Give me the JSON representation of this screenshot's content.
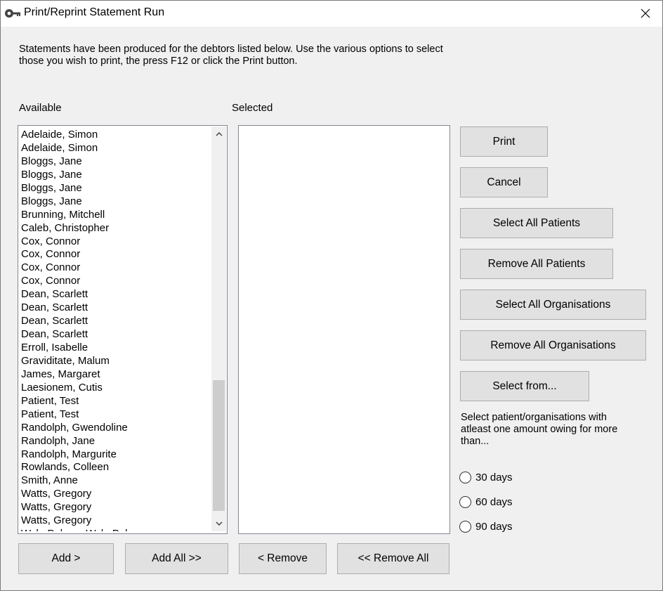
{
  "window": {
    "title": "Print/Reprint Statement Run",
    "close_icon": "close-icon",
    "app_icon": "key-icon"
  },
  "intro": {
    "line1": "Statements have been produced for the debtors listed below. Use the various options to select",
    "line2": "those you wish to print, the press F12 or click the Print button."
  },
  "available": {
    "label": "Available",
    "items": [
      "Adelaide, Simon",
      "Adelaide, Simon",
      "Bloggs, Jane",
      "Bloggs, Jane",
      "Bloggs, Jane",
      "Bloggs, Jane",
      "Brunning, Mitchell",
      "Caleb, Christopher",
      "Cox, Connor",
      "Cox, Connor",
      "Cox, Connor",
      "Cox, Connor",
      "Dean, Scarlett",
      "Dean, Scarlett",
      "Dean, Scarlett",
      "Dean, Scarlett",
      "Erroll, Isabelle",
      "Graviditate, Malum",
      "James, Margaret",
      "Laesionem, Cutis",
      "Patient, Test",
      "Patient, Test",
      "Randolph, Gwendoline",
      "Randolph, Jane",
      "Randolph, Margurite",
      "Rowlands, Colleen",
      "Smith, Anne",
      "Watts, Gregory",
      "Watts, Gregory",
      "Watts, Gregory",
      "Wyle Palmer, Wyle Palmer"
    ]
  },
  "selected": {
    "label": "Selected",
    "items": []
  },
  "buttons": {
    "print": "Print",
    "cancel": "Cancel",
    "select_all_patients": "Select All Patients",
    "remove_all_patients": "Remove All Patients",
    "select_all_organisations": "Select All Organisations",
    "remove_all_organisations": "Remove All Organisations",
    "select_from": "Select from...",
    "add": "Add >",
    "add_all": "Add All >>",
    "remove": "< Remove",
    "remove_all": "<< Remove All"
  },
  "owing": {
    "note_line1": "Select patient/organisations with",
    "note_line2": "atleast one amount owing for more",
    "note_line3": "than...",
    "options": [
      "30 days",
      "60 days",
      "90 days"
    ],
    "selected_option": null
  }
}
